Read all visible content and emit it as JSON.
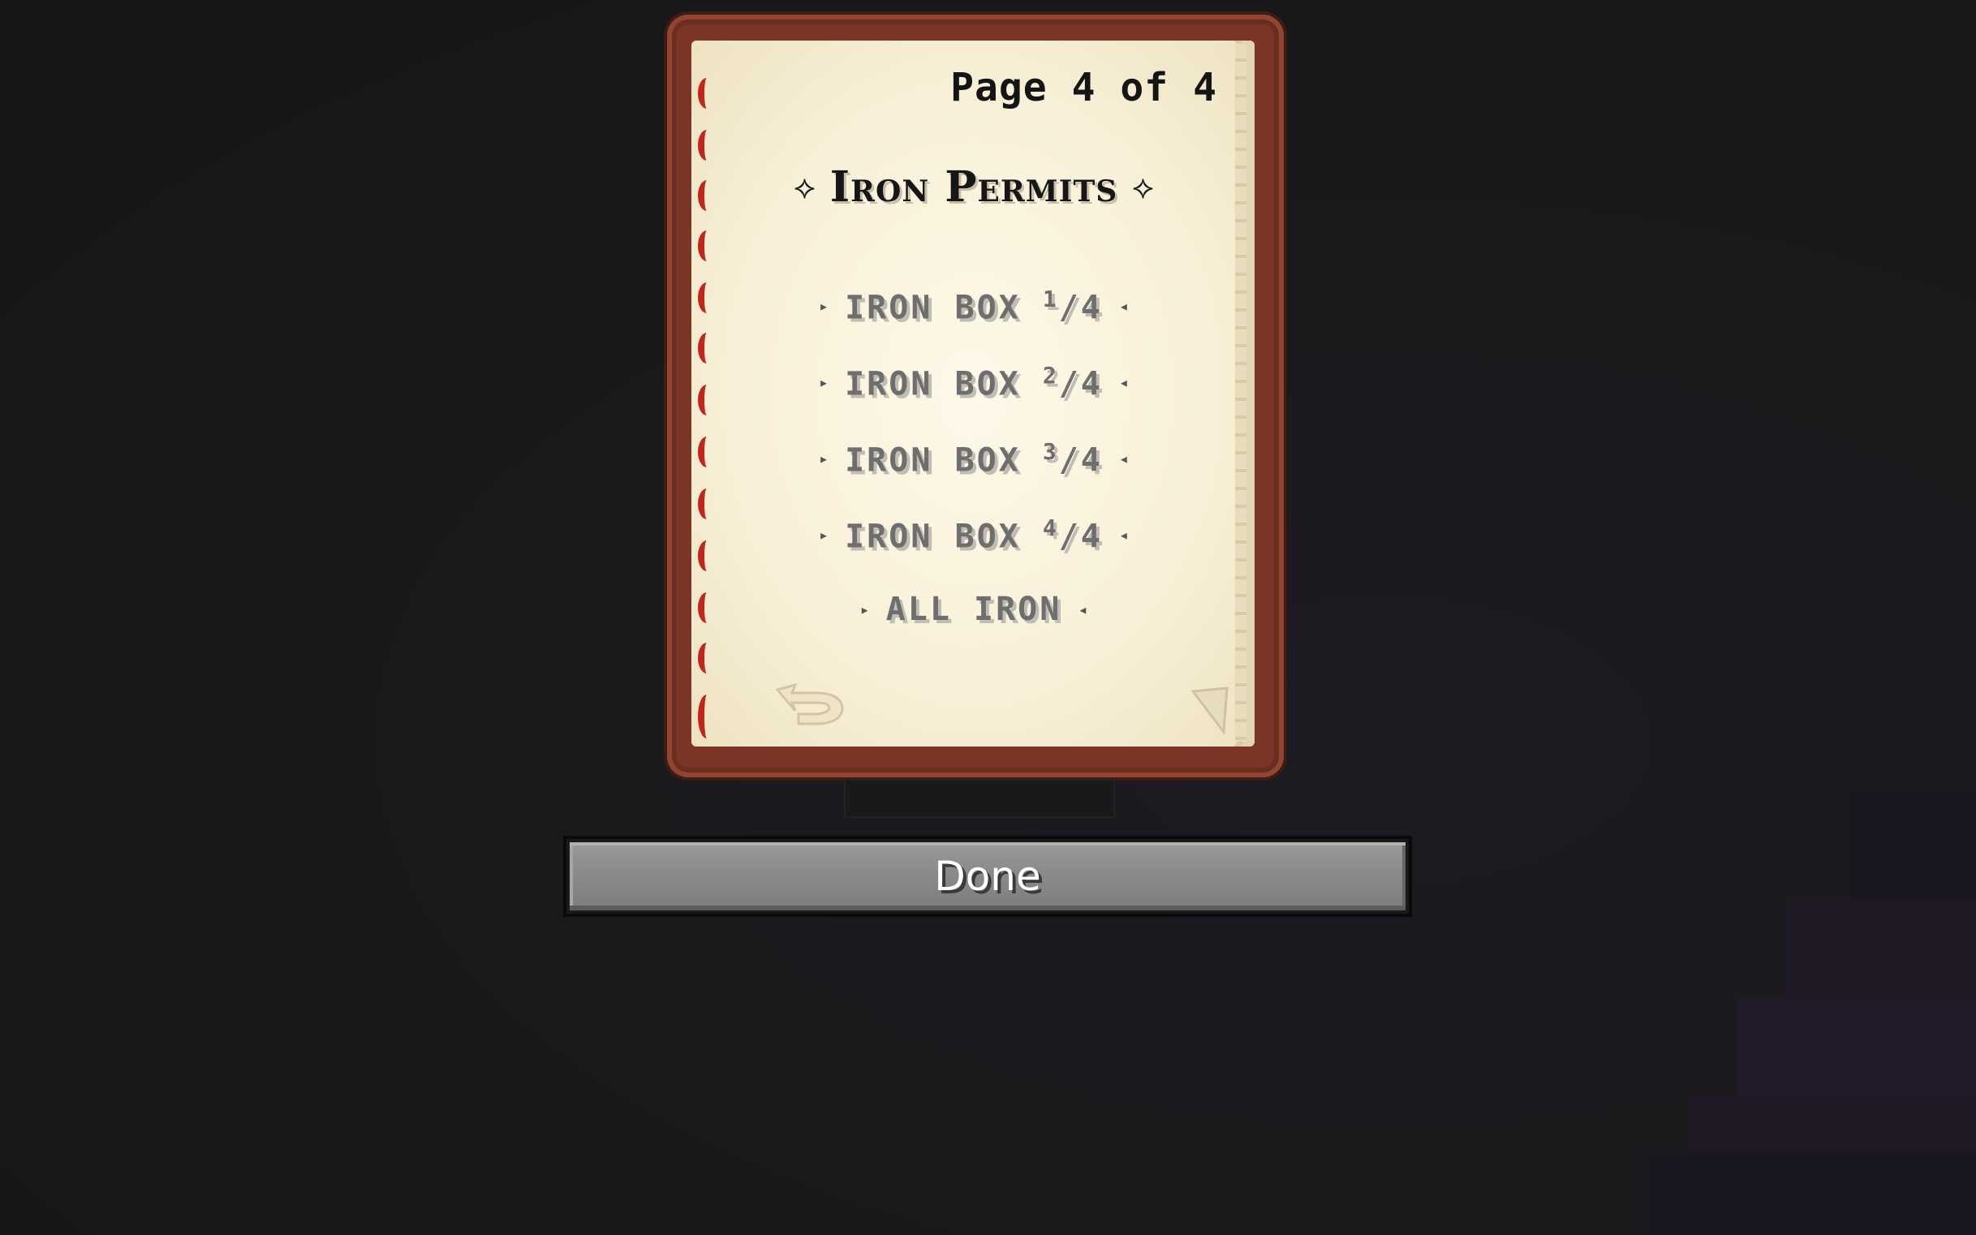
{
  "book": {
    "page_indicator": "Page 4 of 4",
    "title": "Iron Permits",
    "title_icon_left": "sparkle-icon",
    "title_icon_right": "sparkle-icon",
    "entries": [
      {
        "label": "IRON BOX ",
        "num": "1",
        "den": "4"
      },
      {
        "label": "IRON BOX ",
        "num": "2",
        "den": "4"
      },
      {
        "label": "IRON BOX ",
        "num": "3",
        "den": "4"
      },
      {
        "label": "IRON BOX ",
        "num": "4",
        "den": "4"
      },
      {
        "label": "ALL IRON"
      }
    ],
    "back_icon": "back-arrow-icon",
    "corner_icon": "page-corner-fold-icon"
  },
  "done_button": {
    "label": "Done"
  },
  "colors": {
    "background": "#1a1a1c",
    "book_cover": "#7a3526",
    "page": "#f8f0d8",
    "spine_marks": "#c0271c",
    "button": "#8a8a8a"
  }
}
